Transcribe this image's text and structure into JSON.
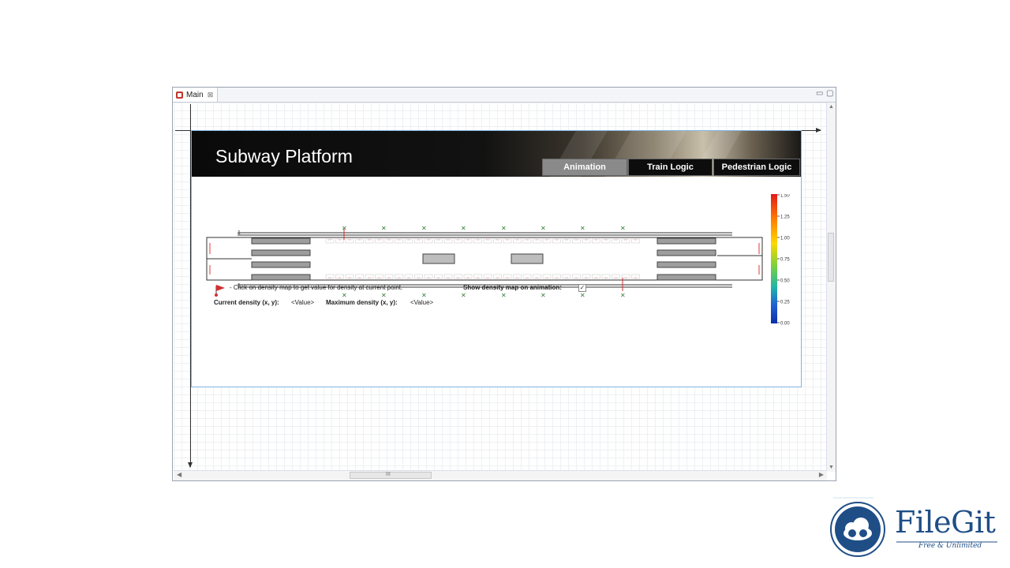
{
  "window": {
    "tab_label": "Main",
    "tab_close": "⊠",
    "minimize": "▭",
    "maximize": "▢",
    "scroll_grip": "III"
  },
  "header": {
    "title": "Subway Platform",
    "tabs": [
      {
        "label": "Animation",
        "active": true
      },
      {
        "label": "Train Logic",
        "active": false
      },
      {
        "label": "Pedestrian Logic",
        "active": false
      }
    ]
  },
  "legend": {
    "ticks": [
      "1.50",
      "1.25",
      "1.00",
      "0.75",
      "0.50",
      "0.25",
      "0.00"
    ],
    "colors": [
      "#e31a1c",
      "#ff7f00",
      "#ffd700",
      "#7fd13b",
      "#1fb5a8",
      "#1f5fd6",
      "#0a2fa8"
    ]
  },
  "controls": {
    "hint": "-  Click on density map to get value for density at current point.",
    "show_density_label": "Show density map on animation:",
    "show_density_checked": true,
    "check_mark": "✓",
    "current_density_label": "Current density (x, y):",
    "current_density_value": "<Value>",
    "max_density_label": "Maximum density (x, y):",
    "max_density_value": "<Value>"
  },
  "platform": {
    "top_marker_label": "1",
    "bottom_marker_label": "1"
  },
  "colors": {
    "accent": "#7fb4e4",
    "marker_green": "#2e7d32",
    "marker_red": "#d32f2f"
  },
  "watermark": {
    "brand": "FileGit",
    "tagline": "Free & Unlimited"
  }
}
